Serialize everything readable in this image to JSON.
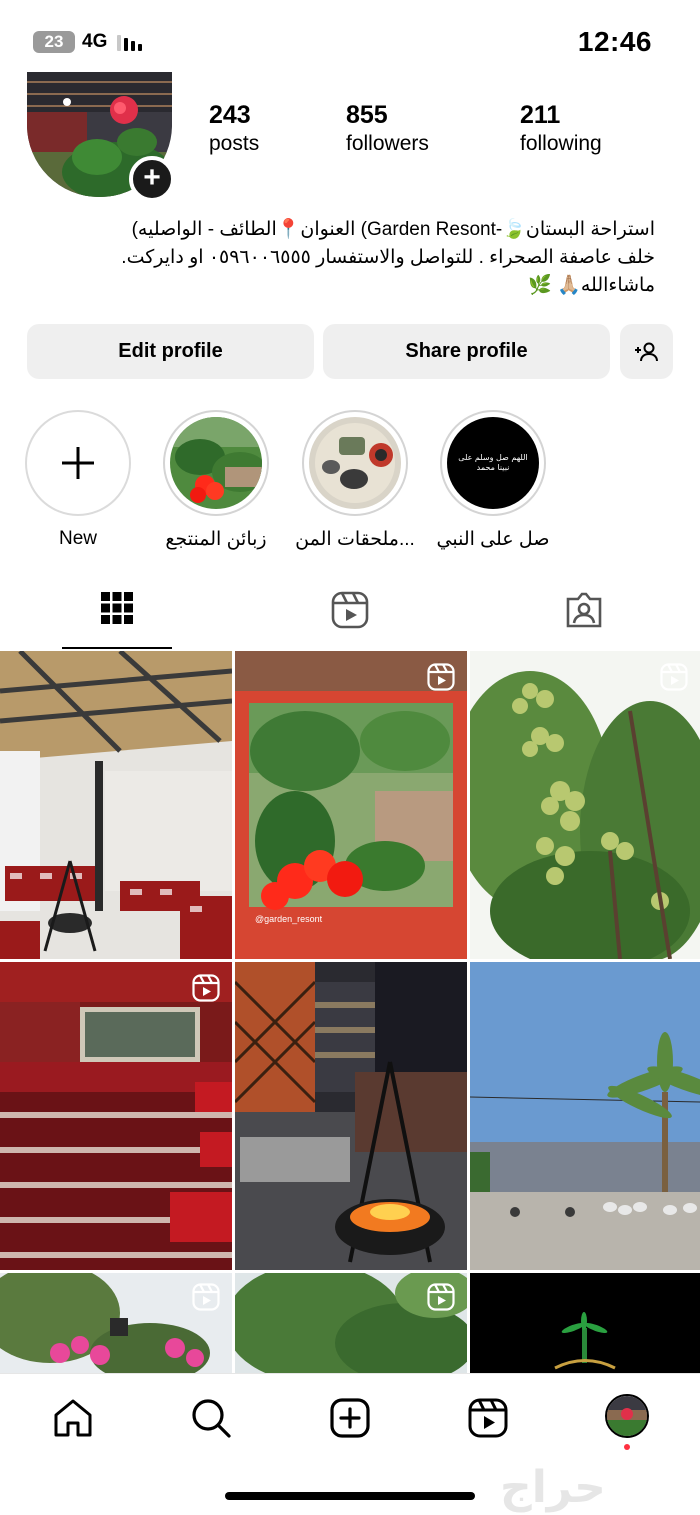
{
  "status_bar": {
    "battery": "23",
    "network": "4G",
    "time": "12:46"
  },
  "profile": {
    "stats": [
      {
        "value": "243",
        "label": "posts"
      },
      {
        "value": "855",
        "label": "followers"
      },
      {
        "value": "211",
        "label": "following"
      }
    ],
    "bio_lines": [
      "استراحة البستان🍃-Garden Resont) العنوان📍الطائف - الواصليه)",
      "خلف عاصفة الصحراء . للتواصل والاستفسار ٠٥٩٦٠٠٦٥٥٥ او دايركت.",
      "ماشاءالله🙏🏼 🌿"
    ],
    "edit_label": "Edit profile",
    "share_label": "Share profile"
  },
  "highlights": [
    {
      "label": "New",
      "icon": "plus-icon"
    },
    {
      "label": "زبائن المنتجع"
    },
    {
      "label": "ملحقات  المن..."
    },
    {
      "label": "صل على النبي"
    }
  ],
  "highlight_cover_text": "اللهم صل وسلم على نبينا محمد",
  "tabs": [
    {
      "icon": "grid-icon",
      "active": true
    },
    {
      "icon": "reels-icon",
      "active": false
    },
    {
      "icon": "tagged-icon",
      "active": false
    }
  ],
  "grid": {
    "story_caption": "@garden_resont"
  },
  "bottom_nav": [
    {
      "icon": "home-icon"
    },
    {
      "icon": "search-icon"
    },
    {
      "icon": "create-icon"
    },
    {
      "icon": "reels-icon"
    },
    {
      "icon": "profile-avatar"
    }
  ],
  "watermark": "حراج",
  "colors": {
    "button_bg": "#efefef",
    "notification_dot": "#ff3040"
  }
}
